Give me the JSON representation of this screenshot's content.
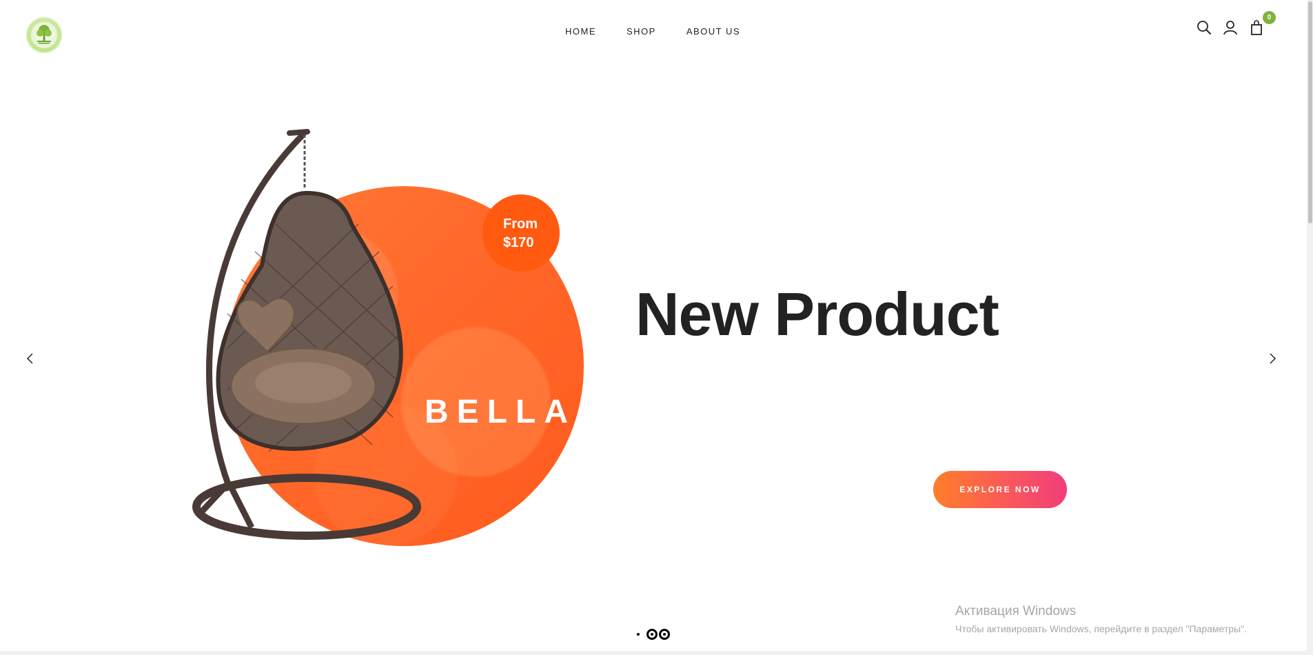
{
  "header": {
    "nav": [
      "HOME",
      "SHOP",
      "ABOUT US"
    ],
    "cart_count": "0",
    "icons": [
      "search-icon",
      "user-icon",
      "cart-icon"
    ]
  },
  "slide": {
    "price_line1": "From",
    "price_line2": "$170",
    "product_name": "BELLA",
    "headline": "New Product",
    "cta_label": "EXPLORE NOW",
    "accent_color": "#ff6a2a",
    "cta_gradient": [
      "#ff7e29",
      "#f23d7a"
    ]
  },
  "slider": {
    "dot_count": 3,
    "active_dot": 1
  },
  "watermark": {
    "title": "Активация Windows",
    "subtitle": "Чтобы активировать Windows, перейдите в раздел \"Параметры\"."
  }
}
